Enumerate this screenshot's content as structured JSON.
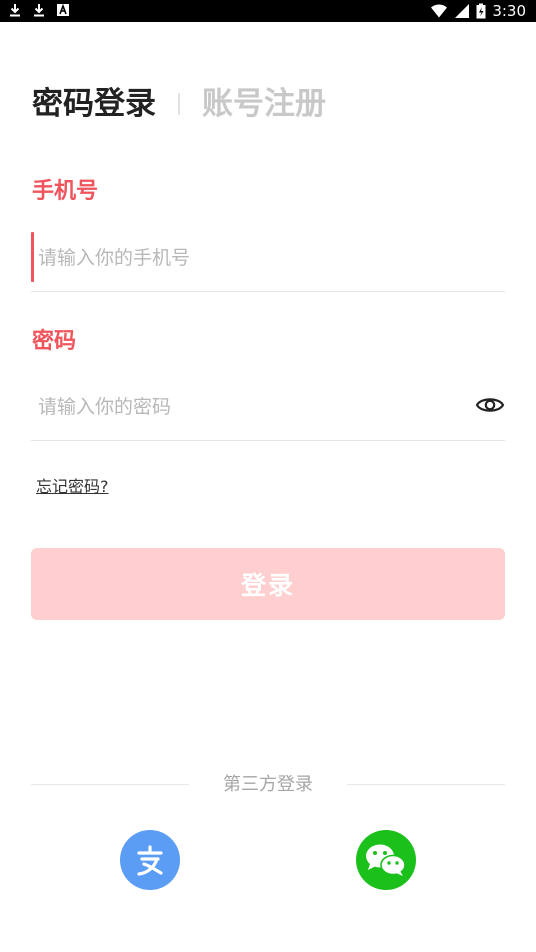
{
  "status_bar": {
    "time": "3:30",
    "left_icons": [
      "download-icon",
      "download-icon",
      "font-a-icon"
    ],
    "right_icons": [
      "wifi-icon",
      "signal-icon",
      "battery-charging-icon"
    ]
  },
  "tabs": {
    "active": "密码登录",
    "inactive": "账号注册"
  },
  "phone": {
    "label": "手机号",
    "placeholder": "请输入你的手机号",
    "value": ""
  },
  "password": {
    "label": "密码",
    "placeholder": "请输入你的密码",
    "value": "",
    "toggle_icon": "eye-icon"
  },
  "forgot_label": "忘记密码?",
  "login_button": "登录",
  "third_party": {
    "label": "第三方登录",
    "providers": [
      {
        "icon": "alipay-icon",
        "color": "#5b9cf5"
      },
      {
        "icon": "wechat-icon",
        "color": "#1bc01b"
      }
    ]
  },
  "colors": {
    "accent": "#f0545c",
    "button_disabled": "#ffcfcf"
  }
}
